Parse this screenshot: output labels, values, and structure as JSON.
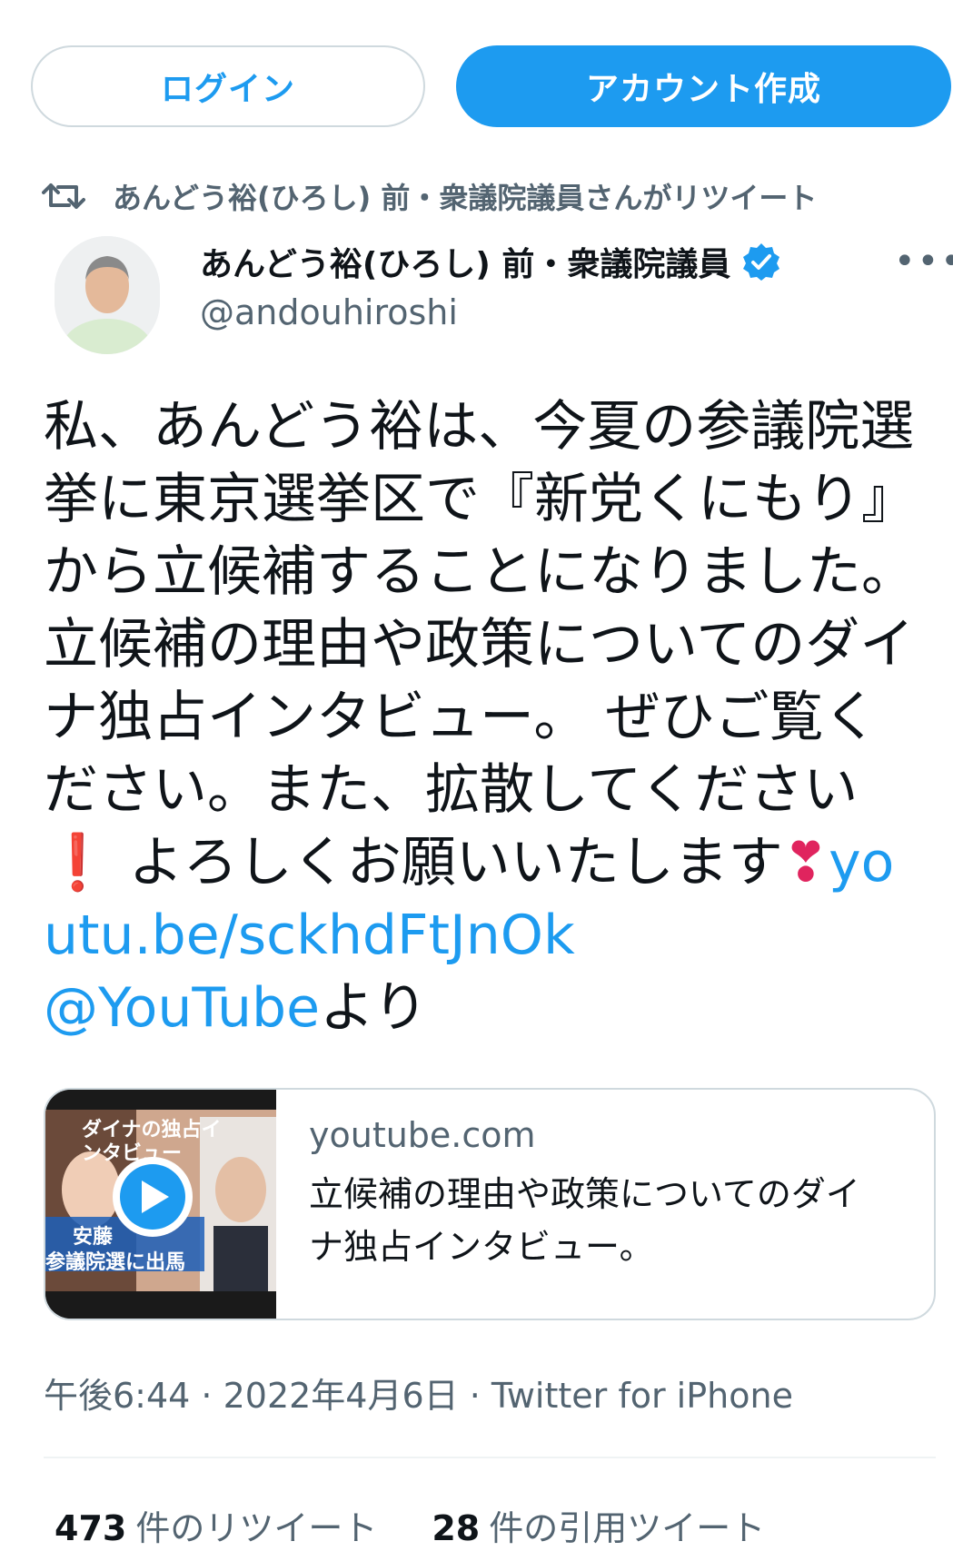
{
  "top_buttons": {
    "login": "ログイン",
    "signup": "アカウント作成"
  },
  "retweet_context": {
    "icon": "retweet-icon",
    "text": "あんどう裕(ひろし) 前・衆議院議員さんがリツイート"
  },
  "author": {
    "name": "あんどう裕(ひろし) 前・衆議院議員",
    "handle": "@andouhiroshi",
    "verified": true
  },
  "tweet": {
    "text_main": "私、あんどう裕は、今夏の参議院選挙に東京選挙区で『新党くにもり』から立候補することになりました。立候補の理由や政策についてのダイナ独占インタビュー。 ぜひご覧ください。また、拡散してください",
    "emoji_exclaim": "❗",
    "text_after_exclaim": " よろしくお願いいたします",
    "emoji_heart": "❣",
    "link": "youtu.be/sckhdFtJnOk",
    "mention": "@YouTube",
    "text_suffix": "より"
  },
  "link_card": {
    "domain": "youtube.com",
    "title": "立候補の理由や政策についてのダイナ独占インタビュー。",
    "thumbnail_text_top": "ダイナの独占インタビュー",
    "thumbnail_text_name": "安藤",
    "thumbnail_text_banner": "参議院選に出馬"
  },
  "meta": {
    "time": "午後6:44",
    "date": "2022年4月6日",
    "source": "Twitter for iPhone",
    "sep": " · "
  },
  "stats": {
    "retweets_count": "473",
    "retweets_label": "件のリツイート",
    "quotes_count": "28",
    "quotes_label": "件の引用ツイート"
  },
  "colors": {
    "accent": "#1d9bf0",
    "secondary_text": "#536471",
    "border": "#cfd9de"
  }
}
